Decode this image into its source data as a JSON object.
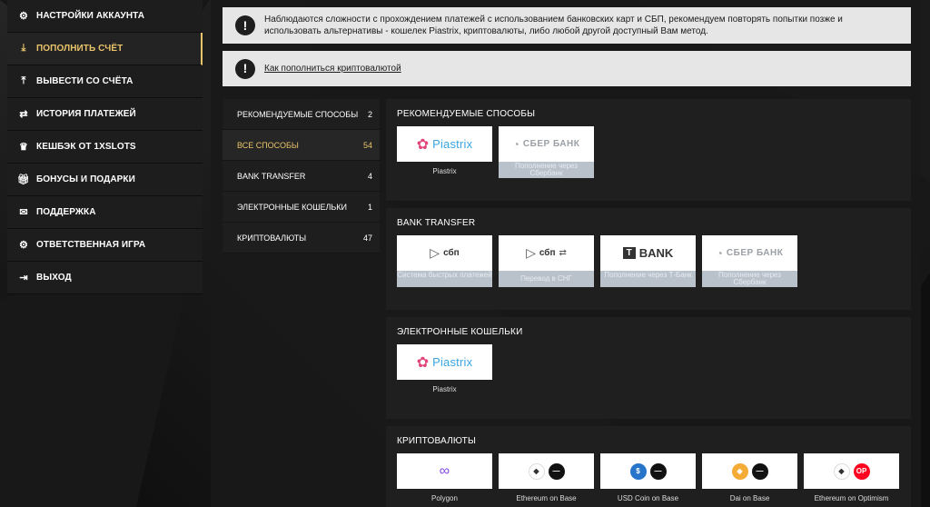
{
  "sidebar": {
    "items": [
      {
        "label": "НАСТРОЙКИ АККАУНТА",
        "icon": "gears-icon"
      },
      {
        "label": "ПОПОЛНИТЬ СЧЁТ",
        "icon": "download-icon",
        "active": true
      },
      {
        "label": "ВЫВЕСТИ СО СЧЁТА",
        "icon": "upload-icon"
      },
      {
        "label": "ИСТОРИЯ ПЛАТЕЖЕЙ",
        "icon": "arrows-icon"
      },
      {
        "label": "КЕШБЭК ОТ 1XSLOTS",
        "icon": "crown-icon"
      },
      {
        "label": "БОНУСЫ И ПОДАРКИ",
        "icon": "gift-icon"
      },
      {
        "label": "ПОДДЕРЖКА",
        "icon": "envelope-icon"
      },
      {
        "label": "ОТВЕТСТВЕННАЯ ИГРА",
        "icon": "gears-icon"
      },
      {
        "label": "ВЫХОД",
        "icon": "logout-icon"
      }
    ]
  },
  "notice": {
    "text": "Наблюдаются сложности с прохождением платежей с использованием банковских карт и СБП, рекомендуем повторять попытки позже и использовать альтернативы - кошелек Piastrix, криптовалюты, либо любой другой доступный Вам метод.",
    "bang": "!"
  },
  "crypto_notice": {
    "link": "Как пополниться криптовалютой",
    "bang": "!"
  },
  "categories": [
    {
      "label": "РЕКОМЕНДУЕМЫЕ СПОСОБЫ",
      "count": "2"
    },
    {
      "label": "ВСЕ СПОСОБЫ",
      "count": "54",
      "active": true
    },
    {
      "label": "BANK TRANSFER",
      "count": "4"
    },
    {
      "label": "ЭЛЕКТРОННЫЕ КОШЕЛЬКИ",
      "count": "1"
    },
    {
      "label": "КРИПТОВАЛЮТЫ",
      "count": "47"
    }
  ],
  "sections": {
    "recommended": {
      "title": "РЕКОМЕНДУЕМЫЕ СПОСОБЫ",
      "cards": [
        {
          "logo": "Piastrix",
          "label": "Piastrix"
        },
        {
          "logo": "СБЕР БАНК",
          "caption": "Пополнение через Сбербанк"
        }
      ]
    },
    "bank": {
      "title": "BANK TRANSFER",
      "cards": [
        {
          "logo": "сбп",
          "caption": "Система быстрых платежей"
        },
        {
          "logo": "сбп",
          "caption": "Перевод в СНГ"
        },
        {
          "logo": "BANK",
          "caption": "Пополнение через Т-Банк"
        },
        {
          "logo": "СБЕР БАНК",
          "caption": "Пополнение через Сбербанк"
        }
      ]
    },
    "wallets": {
      "title": "ЭЛЕКТРОННЫЕ КОШЕЛЬКИ",
      "cards": [
        {
          "logo": "Piastrix",
          "label": "Piastrix"
        }
      ]
    },
    "crypto": {
      "title": "КРИПТОВАЛЮТЫ",
      "cards": [
        {
          "label": "Polygon"
        },
        {
          "label": "Ethereum on Base"
        },
        {
          "label": "USD Coin on Base"
        },
        {
          "label": "Dai on Base"
        },
        {
          "label": "Ethereum on Optimism",
          "badge": "OP"
        }
      ]
    }
  },
  "colors": {
    "accent": "#e9c46a",
    "piastrix": "#38a5e0",
    "caption_bg": "#b9c1cb"
  }
}
